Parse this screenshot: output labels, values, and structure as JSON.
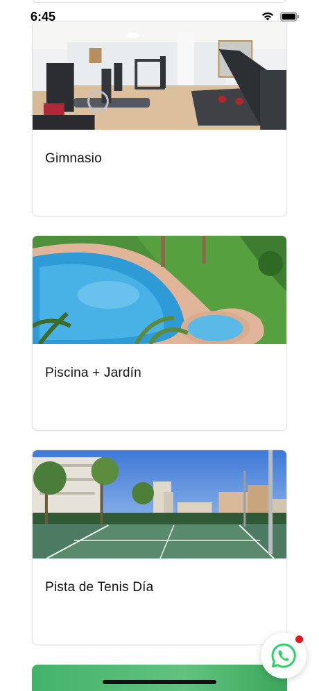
{
  "status_bar": {
    "time": "6:45"
  },
  "cards": [
    {
      "title": "Gimnasio",
      "image_icon": "gym-photo"
    },
    {
      "title": "Piscina + Jardín",
      "image_icon": "pool-garden-photo"
    },
    {
      "title": "Pista de Tenis Día",
      "image_icon": "tennis-court-photo"
    }
  ],
  "whatsapp": {
    "icon": "whatsapp-icon",
    "color": "#25d366",
    "badge_color": "#e8151b"
  }
}
